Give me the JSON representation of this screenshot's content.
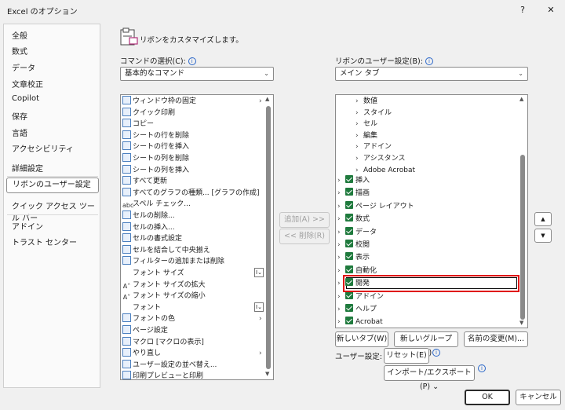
{
  "window": {
    "title": "Excel のオプション",
    "help": "?",
    "close": "✕"
  },
  "sidebar": {
    "items": [
      "全般",
      "数式",
      "データ",
      "文章校正",
      "Copilot",
      "保存",
      "言語",
      "アクセシビリティ",
      "詳細設定",
      "リボンのユーザー設定",
      "クイック アクセス ツール バー",
      "アドイン",
      "トラスト センター"
    ],
    "selected": "リボンのユーザー設定"
  },
  "header": {
    "text": "リボンをカスタマイズします。"
  },
  "commands": {
    "label": "コマンドの選択(C):",
    "selected": "基本的なコマンド",
    "items": [
      {
        "label": "ウィンドウ枠の固定",
        "sub": true
      },
      {
        "label": "クイック印刷"
      },
      {
        "label": "コピー"
      },
      {
        "label": "シートの行を削除"
      },
      {
        "label": "シートの行を挿入"
      },
      {
        "label": "シートの列を削除"
      },
      {
        "label": "シートの列を挿入"
      },
      {
        "label": "すべて更新"
      },
      {
        "label": "すべてのグラフの種類... [グラフの作成]"
      },
      {
        "label": "スペル チェック..."
      },
      {
        "label": "セルの削除..."
      },
      {
        "label": "セルの挿入..."
      },
      {
        "label": "セルの書式設定"
      },
      {
        "label": "セルを結合して中央揃え"
      },
      {
        "label": "フィルターの追加または削除"
      },
      {
        "label": "フォント サイズ",
        "combo": true
      },
      {
        "label": "フォント サイズの拡大"
      },
      {
        "label": "フォント サイズの縮小"
      },
      {
        "label": "フォント",
        "combo": true
      },
      {
        "label": "フォントの色",
        "sub": true
      },
      {
        "label": "ページ設定"
      },
      {
        "label": "マクロ [マクロの表示]"
      },
      {
        "label": "やり直し",
        "sub": true
      },
      {
        "label": "ユーザー設定の並べ替え..."
      },
      {
        "label": "印刷プレビューと印刷"
      }
    ]
  },
  "ribbon": {
    "label": "リボンのユーザー設定(B):",
    "selected": "メイン タブ",
    "groups": [
      "数値",
      "スタイル",
      "セル",
      "編集",
      "アドイン",
      "アシスタンス",
      "Adobe Acrobat"
    ],
    "tabs": [
      "挿入",
      "描画",
      "ページ レイアウト",
      "数式",
      "データ",
      "校閲",
      "表示",
      "自動化",
      "開発",
      "アドイン",
      "ヘルプ",
      "Acrobat"
    ],
    "highlighted_tab": "開発"
  },
  "buttons": {
    "add": "追加(A) >>",
    "remove": "<< 削除(R)",
    "new_tab": "新しいタブ(W)",
    "new_group": "新しいグループ(N)",
    "rename": "名前の変更(M)...",
    "user_settings_label": "ユーザー設定:",
    "reset": "リセット(E) ⌄",
    "import_export": "インポート/エクスポート(P) ⌄",
    "ok": "OK",
    "cancel": "キャンセル"
  }
}
